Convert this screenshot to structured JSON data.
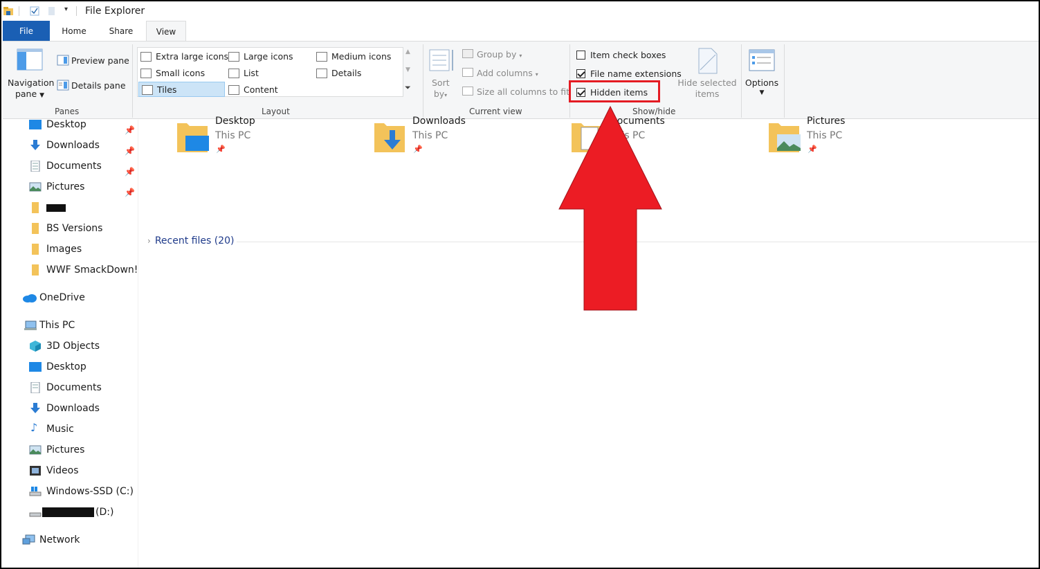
{
  "window": {
    "title": "File Explorer"
  },
  "ribbon_tabs": [
    {
      "label": "File"
    },
    {
      "label": "Home"
    },
    {
      "label": "Share"
    },
    {
      "label": "View"
    }
  ],
  "panes": {
    "group_label": "Panes",
    "navigation_pane": [
      "Navigation",
      "pane"
    ],
    "preview_pane": "Preview pane",
    "details_pane": "Details pane"
  },
  "layout": {
    "group_label": "Layout",
    "items": [
      "Extra large icons",
      "Large icons",
      "Medium icons",
      "Small icons",
      "List",
      "Details",
      "Tiles",
      "Content"
    ],
    "selected": "Tiles"
  },
  "current_view": {
    "group_label": "Current view",
    "sort_by": [
      "Sort",
      "by"
    ],
    "group_by": "Group by",
    "add_columns": "Add columns",
    "size_all_columns": "Size all columns to fit"
  },
  "show_hide": {
    "group_label": "Show/hide",
    "item_check_boxes": {
      "label": "Item check boxes",
      "checked": false
    },
    "file_name_extensions": {
      "label": "File name extensions",
      "checked": true
    },
    "hidden_items": {
      "label": "Hidden items",
      "checked": true
    },
    "hide_selected_items": [
      "Hide selected",
      "items"
    ]
  },
  "options": {
    "label": "Options"
  },
  "nav_pane": {
    "quick_access": [
      {
        "label": "Desktop",
        "icon": "desktop-icon",
        "pinned": true
      },
      {
        "label": "Downloads",
        "icon": "download-icon",
        "pinned": true
      },
      {
        "label": "Documents",
        "icon": "documents-icon",
        "pinned": true
      },
      {
        "label": "Pictures",
        "icon": "pictures-icon",
        "pinned": true
      },
      {
        "label": "",
        "icon": "folder-icon",
        "pinned": false,
        "redacted": true
      },
      {
        "label": "BS Versions",
        "icon": "folder-icon",
        "pinned": false
      },
      {
        "label": "Images",
        "icon": "folder-icon",
        "pinned": false
      },
      {
        "label": "WWF SmackDown!",
        "icon": "folder-icon",
        "pinned": false
      }
    ],
    "onedrive": "OneDrive",
    "this_pc": "This PC",
    "this_pc_items": [
      {
        "label": "3D Objects",
        "icon": "3d-objects-icon"
      },
      {
        "label": "Desktop",
        "icon": "desktop-icon"
      },
      {
        "label": "Documents",
        "icon": "documents-icon"
      },
      {
        "label": "Downloads",
        "icon": "download-icon"
      },
      {
        "label": "Music",
        "icon": "music-icon"
      },
      {
        "label": "Pictures",
        "icon": "pictures-icon"
      },
      {
        "label": "Videos",
        "icon": "videos-icon"
      },
      {
        "label": "Windows-SSD (C:)",
        "icon": "drive-icon"
      },
      {
        "label": "(D:)",
        "icon": "drive-icon",
        "redacted_prefix": true
      }
    ],
    "network": "Network"
  },
  "frequent_folders": [
    {
      "name": "Desktop",
      "location": "This PC"
    },
    {
      "name": "Downloads",
      "location": "This PC"
    },
    {
      "name": "Documents",
      "location": "This PC"
    },
    {
      "name": "Pictures",
      "location": "This PC"
    }
  ],
  "recent_files": {
    "label": "Recent files (20)"
  },
  "colors": {
    "accent": "#1a5fb4",
    "annotation_red": "#e41b23",
    "folder_yellow": "#f3c35a"
  }
}
